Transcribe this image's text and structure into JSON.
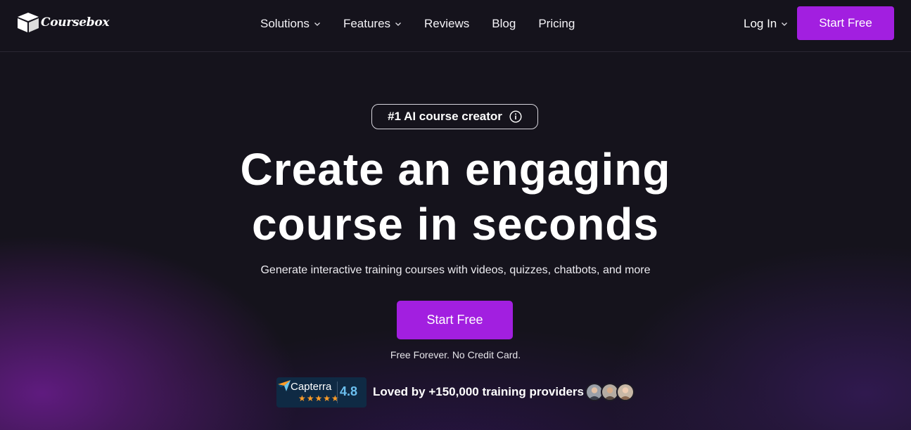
{
  "header": {
    "logo_text": "Coursebox",
    "nav": [
      {
        "label": "Solutions",
        "has_dropdown": true
      },
      {
        "label": "Features",
        "has_dropdown": true
      },
      {
        "label": "Reviews",
        "has_dropdown": false
      },
      {
        "label": "Blog",
        "has_dropdown": false
      },
      {
        "label": "Pricing",
        "has_dropdown": false
      }
    ],
    "login_label": "Log In",
    "start_label": "Start Free"
  },
  "hero": {
    "badge_text": "#1 AI course creator",
    "headline_line1": "Create an engaging",
    "headline_line2": "course in seconds",
    "subline": "Generate interactive training courses with videos, quizzes, chatbots, and more",
    "cta_label": "Start Free",
    "note": "Free Forever. No Credit Card."
  },
  "social_proof": {
    "capterra_name": "Capterra",
    "capterra_stars": "★★★★★",
    "capterra_score": "4.8",
    "loved_text": "Loved by +150,000 training providers"
  },
  "colors": {
    "accent": "#a21fe0",
    "background": "#15131c",
    "capterra_bg": "#0f2a44",
    "capterra_score": "#6cc0f0"
  },
  "icons": {
    "logo": "box-icon",
    "info": "info-icon",
    "dropdown": "chevron-down-icon"
  }
}
